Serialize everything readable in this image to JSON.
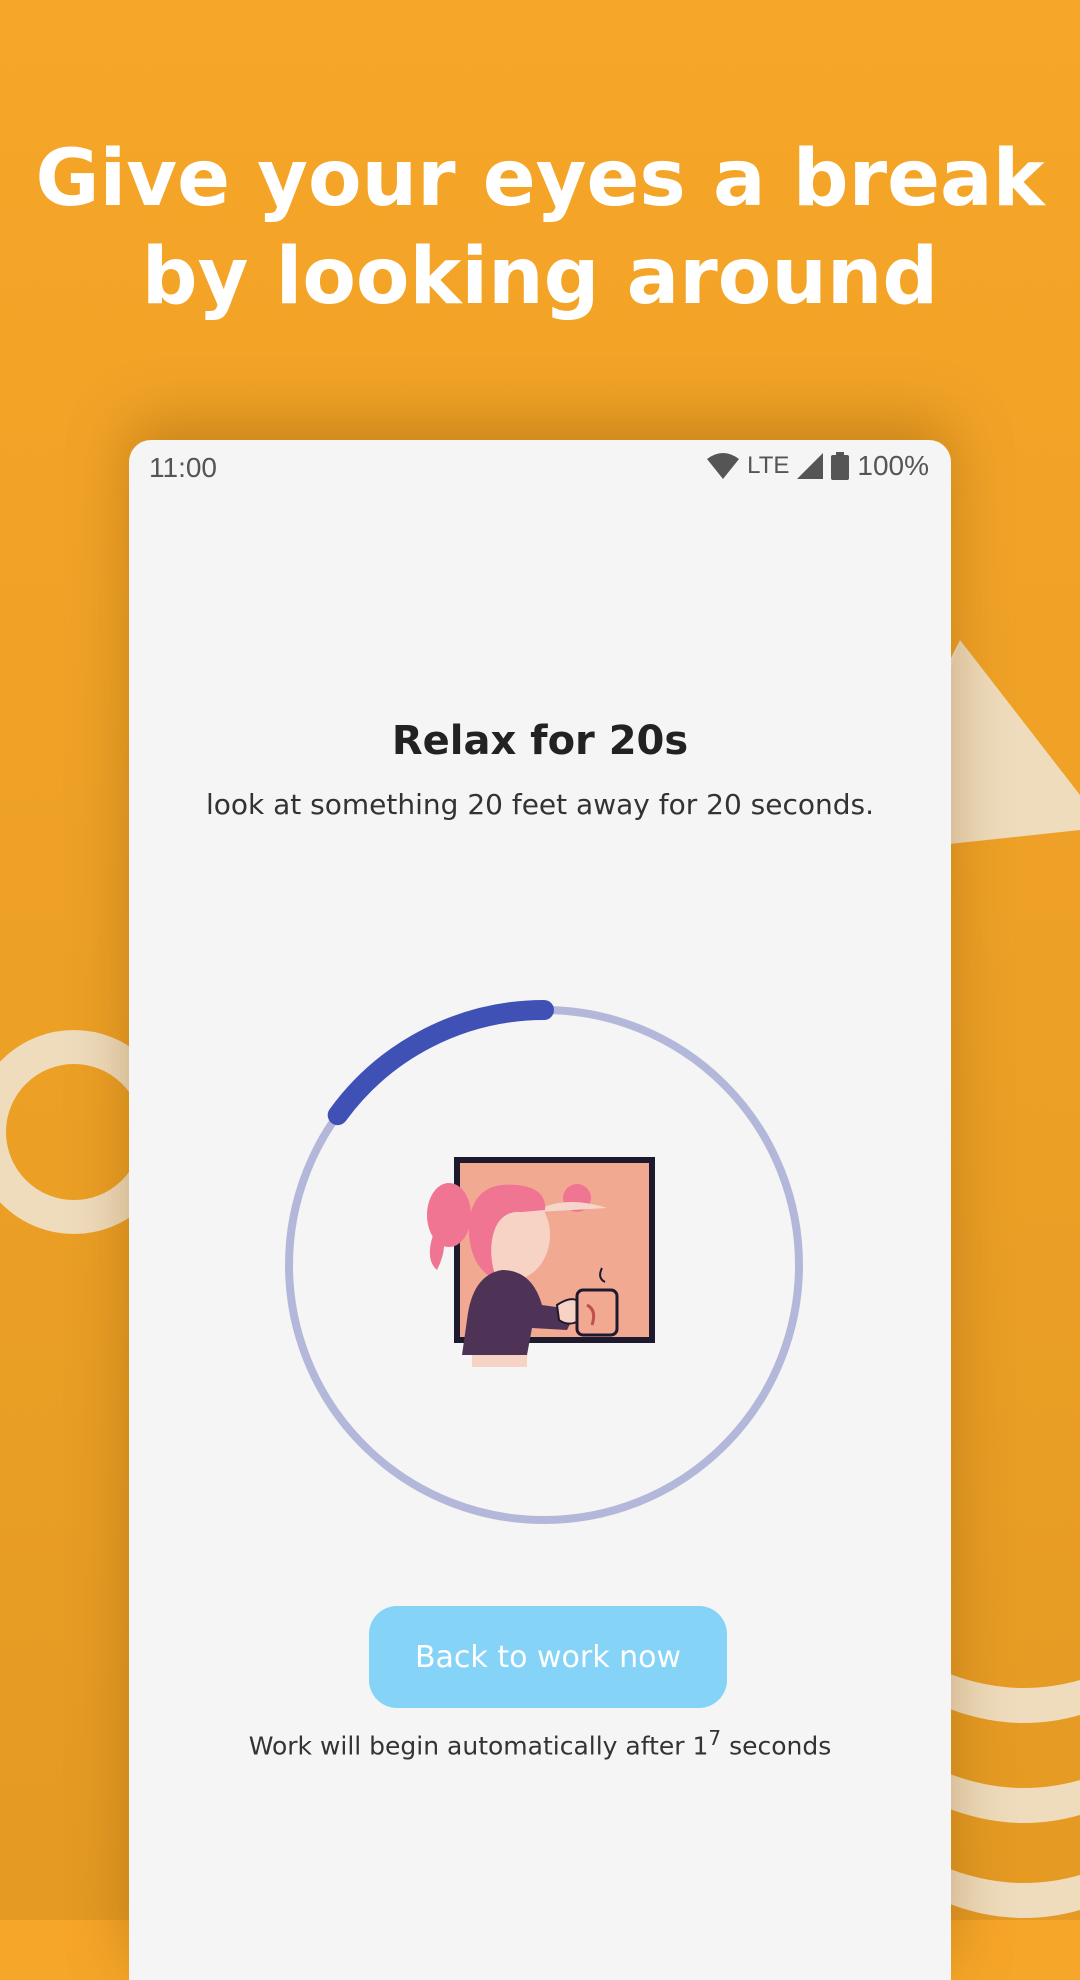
{
  "headline": {
    "line1": "Give your eyes a break",
    "line2": "by looking around"
  },
  "status_bar": {
    "time": "11:00",
    "network": "LTE",
    "battery": "100%",
    "icons": [
      "wifi-icon",
      "signal-icon",
      "battery-icon"
    ]
  },
  "screen": {
    "title": "Relax for 20s",
    "subtitle": "look at something 20 feet away for 20 seconds.",
    "timer_progress": 0.15,
    "illustration": "person-looking-out-window-with-mug",
    "button_label": "Back to work now",
    "auto_note": {
      "prefix": "Work will begin automatically after 1",
      "superscript": "7",
      "suffix": " seconds"
    }
  },
  "colors": {
    "background": "#f6a628",
    "accent_progress": "#3f51b5",
    "ring_track": "#b3b8da",
    "button": "#85d3f7",
    "phone_screen": "#f5f5f6"
  }
}
